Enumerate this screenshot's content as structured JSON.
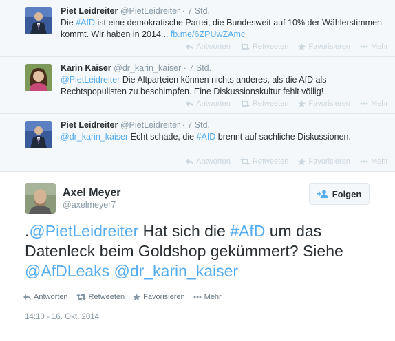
{
  "thread": [
    {
      "name": "Piet Leidreiter",
      "handle": "@PietLeidreiter",
      "time": "7 Std.",
      "text_1": "Die ",
      "text_link_1": "#AfD",
      "text_2": " ist eine demokratische Partei, die Bundesweit auf 10% der Wählerstimmen kommt. Wir haben in 2014... ",
      "text_link_2": "fb.me/6ZPUwZAmc"
    },
    {
      "name": "Karin Kaiser",
      "handle": "@dr_karin_kaiser",
      "time": "7 Std.",
      "text_link_1": "@PietLeidreiter",
      "text_2": " Die Altparteien können nichts anderes, als die AfD als Rechtspopulisten zu beschimpfen. Eine Diskussionskultur fehlt völlig!"
    },
    {
      "name": "Piet Leidreiter",
      "handle": "@PietLeidreiter",
      "time": "7 Std.",
      "text_link_1": "@dr_karin_kaiser",
      "text_2": " Echt schade, die ",
      "text_link_2": "#AfD",
      "text_3": " brennt auf sachliche Diskussionen."
    }
  ],
  "actions_small": {
    "reply": "Antworten",
    "retweet": "Retweeten",
    "favorite": "Favorisieren",
    "more": "Mehr"
  },
  "main_tweet": {
    "name": "Axel Meyer",
    "handle": "@axelmeyer7",
    "follow_label": "Folgen",
    "t0": ".",
    "l1": "@PietLeidreiter",
    "t1": " Hat sich die ",
    "l2": "#AfD",
    "t2": " um das Datenleck beim Goldshop gekümmert? Siehe ",
    "l3": "@AfDLeaks",
    "t3": " ",
    "l4": "@dr_karin_kaiser",
    "actions": {
      "reply": "Antworten",
      "retweet": "Retweeten",
      "favorite": "Favorisieren",
      "more": "Mehr"
    },
    "date": "14:10 - 16. Okt. 2014"
  },
  "colors": {
    "link": "#55acee",
    "thread_bg": "#f5f8fa"
  }
}
